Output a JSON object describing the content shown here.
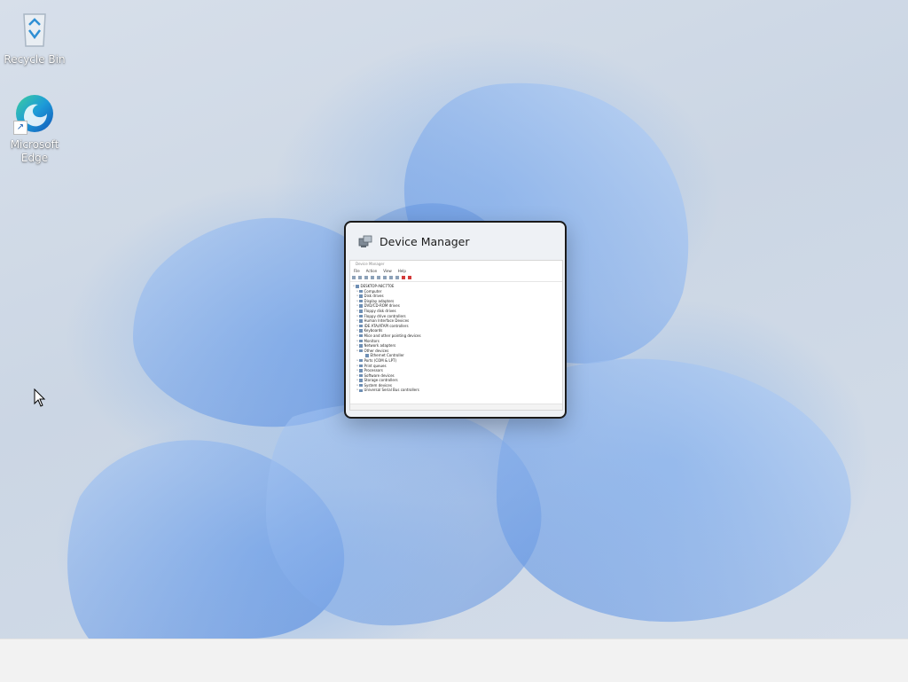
{
  "desktop": {
    "icons": [
      {
        "label": "Recycle Bin",
        "icon": "recycle-bin-icon"
      },
      {
        "label": "Microsoft Edge",
        "icon": "edge-icon"
      }
    ]
  },
  "switcher": {
    "window_title": "Device Manager",
    "app_icon": "device-manager-icon",
    "thumbnail": {
      "title_text": "Device Manager",
      "menu": [
        "File",
        "Action",
        "View",
        "Help"
      ],
      "tree": [
        {
          "label": "DESKTOP-A8C7T0E",
          "level": 0,
          "expander": "v"
        },
        {
          "label": "Computer",
          "level": 1,
          "expander": ">"
        },
        {
          "label": "Disk drives",
          "level": 1,
          "expander": ">"
        },
        {
          "label": "Display adapters",
          "level": 1,
          "expander": ">"
        },
        {
          "label": "DVD/CD-ROM drives",
          "level": 1,
          "expander": ">"
        },
        {
          "label": "Floppy disk drives",
          "level": 1,
          "expander": ">"
        },
        {
          "label": "Floppy drive controllers",
          "level": 1,
          "expander": ">"
        },
        {
          "label": "Human Interface Devices",
          "level": 1,
          "expander": ">"
        },
        {
          "label": "IDE ATA/ATAPI controllers",
          "level": 1,
          "expander": ">"
        },
        {
          "label": "Keyboards",
          "level": 1,
          "expander": ">"
        },
        {
          "label": "Mice and other pointing devices",
          "level": 1,
          "expander": ">"
        },
        {
          "label": "Monitors",
          "level": 1,
          "expander": ">"
        },
        {
          "label": "Network adapters",
          "level": 1,
          "expander": ">"
        },
        {
          "label": "Other devices",
          "level": 1,
          "expander": "v"
        },
        {
          "label": "Ethernet Controller",
          "level": 2,
          "expander": ""
        },
        {
          "label": "Ports (COM & LPT)",
          "level": 1,
          "expander": ">"
        },
        {
          "label": "Print queues",
          "level": 1,
          "expander": ">"
        },
        {
          "label": "Processors",
          "level": 1,
          "expander": ">"
        },
        {
          "label": "Software devices",
          "level": 1,
          "expander": ">"
        },
        {
          "label": "Storage controllers",
          "level": 1,
          "expander": ">"
        },
        {
          "label": "System devices",
          "level": 1,
          "expander": ">"
        },
        {
          "label": "Universal Serial Bus controllers",
          "level": 1,
          "expander": ">"
        }
      ]
    }
  },
  "colors": {
    "taskbar": "#f2f2f2",
    "card_border": "#1a1a1a",
    "accent": "#3b82f6"
  }
}
